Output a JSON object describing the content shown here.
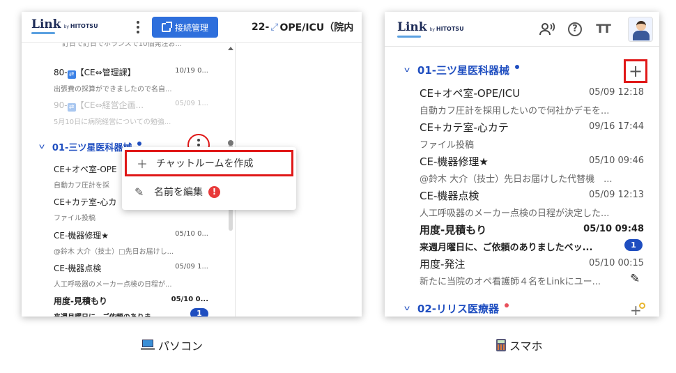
{
  "pc": {
    "logo": {
      "main": "Link",
      "by": "by",
      "company": "HITOTSU"
    },
    "connection_button": "接続管理",
    "peek_text": "訂日で訂日でホランスで10個発注お...",
    "right_header": {
      "prefix": "22-",
      "title": "OPE/ICU（院内"
    },
    "list_top": [
      {
        "num": "80-",
        "title": "【CE⇔管理課】",
        "time": "10/19 0...",
        "sub": "出張費の採算ができましたので名自...",
        "faded": false
      },
      {
        "num": "90-",
        "title": "【CE⇔経営企画...",
        "time": "05/09 1...",
        "sub": "5月10日に病院経営についての勉強...",
        "faded": true
      }
    ],
    "group": {
      "name": "01-三ツ星医科器械"
    },
    "rooms": [
      {
        "title": "CE+オペ室-OPE",
        "time": "",
        "sub": "自動カフ圧計を採",
        "bold": false
      },
      {
        "title": "CE+カテ室-心カ",
        "time": "",
        "sub": "ファイル投稿",
        "bold": false
      },
      {
        "title": "CE-機器修理★",
        "time": "05/10 0...",
        "sub": "@鈴木 大介（技士）□先日お届けし...",
        "bold": false
      },
      {
        "title": "CE-機器点検",
        "time": "05/09 1...",
        "sub": "人工呼吸器のメーカー点検の日程が...",
        "bold": false
      },
      {
        "title": "用度-見積もり",
        "time": "05/10 0...",
        "sub": "来週月曜日に、ご依頼のありま...",
        "bold": true,
        "badge": "1"
      }
    ],
    "menu": {
      "create_room": "チャットルームを作成",
      "rename": "名前を編集",
      "warn_mark": "!"
    }
  },
  "sp": {
    "logo": {
      "main": "Link",
      "by": "by",
      "company": "HITOTSU"
    },
    "groups": [
      {
        "name": "01-三ツ星医科器械"
      },
      {
        "name": "02-リリス医療器"
      }
    ],
    "rooms": [
      {
        "title": "CE+オペ室-OPE/ICU",
        "time": "05/09 12:18",
        "sub": "自動カフ圧計を採用したいので何社かデモを...",
        "bold": false
      },
      {
        "title": "CE+カテ室-心カテ",
        "time": "09/16 17:44",
        "sub": "ファイル投稿",
        "bold": false
      },
      {
        "title": "CE-機器修理★",
        "time": "05/10 09:46",
        "sub": "@鈴木 大介（技士）先日お届けした代替機　...",
        "bold": false
      },
      {
        "title": "CE-機器点検",
        "time": "05/09 12:13",
        "sub": "人工呼吸器のメーカー点検の日程が決定した...",
        "bold": false
      },
      {
        "title": "用度-見積もり",
        "time": "05/10 09:48",
        "sub": "来週月曜日に、ご依頼のありましたベッ...",
        "bold": true,
        "badge": "1"
      },
      {
        "title": "用度-発注",
        "time": "05/10 00:15",
        "sub": "新たに当院のオペ看護師４名をLinkにユー...",
        "bold": false
      }
    ]
  },
  "captions": {
    "pc": "パソコン",
    "sp": "スマホ"
  },
  "colors": {
    "accent": "#1f4ec0",
    "button": "#2e6fdc",
    "highlight": "#e01818"
  }
}
